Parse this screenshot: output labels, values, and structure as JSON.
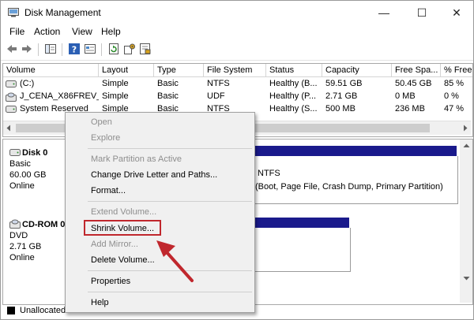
{
  "window": {
    "title": "Disk Management",
    "minimize_glyph": "—",
    "maximize_glyph": "☐",
    "close_glyph": "✕"
  },
  "menubar": {
    "items": [
      "File",
      "Action",
      "View",
      "Help"
    ]
  },
  "toolbar": {
    "icons": [
      "back-icon",
      "forward-icon",
      "console-tree-icon",
      "help-icon",
      "properties-icon",
      "refresh-icon",
      "settings-icon",
      "export-icon"
    ]
  },
  "volume_table": {
    "columns": [
      "Volume",
      "Layout",
      "Type",
      "File System",
      "Status",
      "Capacity",
      "Free Spa...",
      "% Free"
    ],
    "rows": [
      {
        "volume": "(C:)",
        "layout": "Simple",
        "type": "Basic",
        "fs": "NTFS",
        "status": "Healthy (B...",
        "capacity": "59.51 GB",
        "free": "50.45 GB",
        "pct": "85 %"
      },
      {
        "volume": "J_CENA_X86FREV_...",
        "layout": "Simple",
        "type": "Basic",
        "fs": "UDF",
        "status": "Healthy (P...",
        "capacity": "2.71 GB",
        "free": "0 MB",
        "pct": "0 %"
      },
      {
        "volume": "System Reserved",
        "layout": "Simple",
        "type": "Basic",
        "fs": "NTFS",
        "status": "Healthy (S...",
        "capacity": "500 MB",
        "free": "236 MB",
        "pct": "47 %"
      }
    ]
  },
  "disks": [
    {
      "name": "Disk 0",
      "kind": "Basic",
      "size": "60.00 GB",
      "state": "Online",
      "partition_fs": "NTFS",
      "partition_status": "(Boot, Page File, Crash Dump, Primary Partition)"
    },
    {
      "name": "CD-ROM 0",
      "kind": "DVD",
      "size": "2.71 GB",
      "state": "Online"
    }
  ],
  "legend": {
    "unallocated": "Unallocated"
  },
  "context_menu": {
    "items": [
      {
        "label": "Open",
        "enabled": false
      },
      {
        "label": "Explore",
        "enabled": false
      },
      {
        "label": "Mark Partition as Active",
        "enabled": false
      },
      {
        "label": "Change Drive Letter and Paths...",
        "enabled": true
      },
      {
        "label": "Format...",
        "enabled": true
      },
      {
        "label": "Extend Volume...",
        "enabled": false
      },
      {
        "label": "Shrink Volume...",
        "enabled": true
      },
      {
        "label": "Add Mirror...",
        "enabled": false
      },
      {
        "label": "Delete Volume...",
        "enabled": true
      },
      {
        "label": "Properties",
        "enabled": true
      },
      {
        "label": "Help",
        "enabled": true
      }
    ]
  },
  "colors": {
    "highlight_box": "#c0272d",
    "annotation_arrow": "#c0272d",
    "partition_bar": "#1a1a8c",
    "menu_bg": "#f0f0f0",
    "disabled_text": "#8e8e8e"
  }
}
